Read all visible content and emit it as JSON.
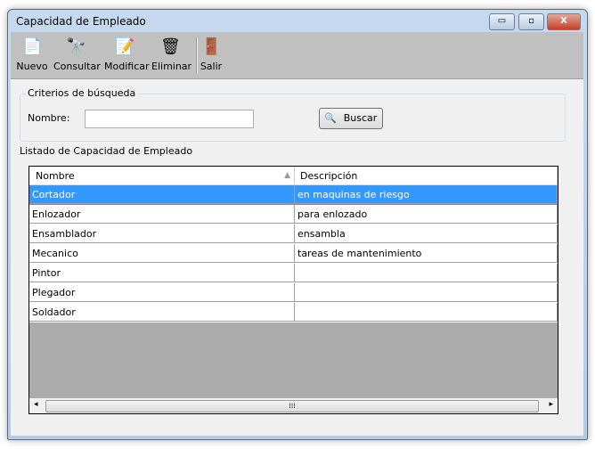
{
  "window": {
    "title": "Capacidad de Empleado",
    "minimize": "▭",
    "maximize": "▫",
    "close": "X"
  },
  "toolbar": [
    {
      "label": "Nuevo",
      "icon": "📄"
    },
    {
      "label": "Consultar",
      "icon": "🔭"
    },
    {
      "label": "Modificar",
      "icon": "📝"
    },
    {
      "label": "Eliminar",
      "icon": "🗑"
    },
    {
      "label": "Salir",
      "icon": "🚪"
    }
  ],
  "search": {
    "group_label": "Criterios de búsqueda",
    "name_label": "Nombre:",
    "name_value": "",
    "button_label": "Buscar",
    "button_icon": "🔍"
  },
  "list": {
    "group_label": "Listado de Capacidad de Empleado",
    "columns": [
      "Nombre",
      "Descripción"
    ],
    "sort_icon": "▲",
    "rows": [
      [
        "Cortador",
        "en maquinas de riesgo"
      ],
      [
        "Enlozador",
        "para enlozado"
      ],
      [
        "Ensamblador",
        "ensambla"
      ],
      [
        "Mecanico",
        "tareas de mantenimiento"
      ],
      [
        "Pintor",
        ""
      ],
      [
        "Plegador",
        ""
      ],
      [
        "Soldador",
        ""
      ]
    ],
    "selected_row": 0,
    "scroll_left": "◂",
    "scroll_right": "▸",
    "scroll_grip": "⁞⁞⁞"
  }
}
